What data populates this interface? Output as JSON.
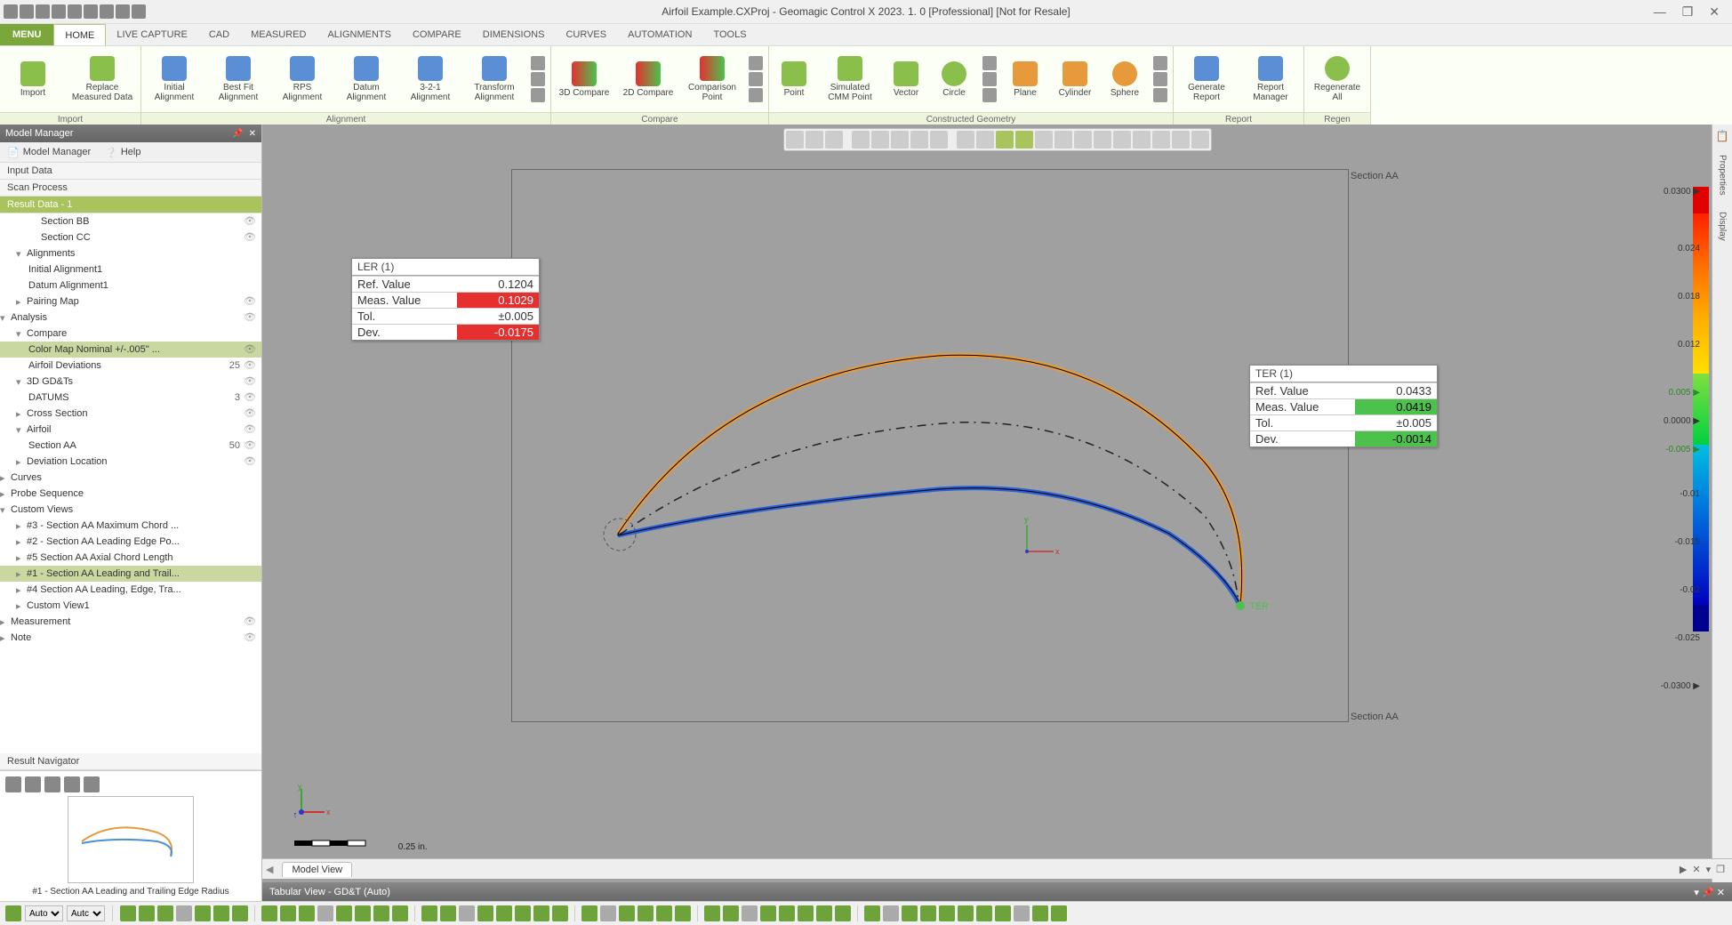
{
  "window": {
    "title": "Airfoil Example.CXProj - Geomagic Control X 2023. 1. 0 [Professional] [Not for Resale]"
  },
  "ribbon": {
    "menu": "MENU",
    "tabs": [
      "HOME",
      "LIVE CAPTURE",
      "CAD",
      "MEASURED",
      "ALIGNMENTS",
      "COMPARE",
      "DIMENSIONS",
      "CURVES",
      "AUTOMATION",
      "TOOLS"
    ],
    "active_tab": 0,
    "groups": [
      {
        "label": "Import",
        "buttons": [
          "Import",
          "Replace Measured Data"
        ]
      },
      {
        "label": "Alignment",
        "buttons": [
          "Initial Alignment",
          "Best Fit Alignment",
          "RPS Alignment",
          "Datum Alignment",
          "3-2-1 Alignment",
          "Transform Alignment"
        ]
      },
      {
        "label": "Compare",
        "buttons": [
          "3D Compare",
          "2D Compare",
          "Comparison Point"
        ]
      },
      {
        "label": "Constructed Geometry",
        "buttons": [
          "Point",
          "Simulated CMM Point",
          "Vector",
          "Circle",
          "",
          "Plane",
          "Cylinder",
          "Sphere",
          ""
        ]
      },
      {
        "label": "Report",
        "buttons": [
          "Generate Report",
          "Report Manager"
        ]
      },
      {
        "label": "Regen",
        "buttons": [
          "Regenerate All"
        ]
      }
    ]
  },
  "left": {
    "panel_title": "Model Manager",
    "tab1": "Model Manager",
    "tab2": "Help",
    "sect_input": "Input Data",
    "sect_scan": "Scan Process",
    "sect_result": "Result Data - 1",
    "sect_nav": "Result Navigator",
    "tree": [
      {
        "lbl": "Section BB",
        "ind": 3,
        "eye": 1
      },
      {
        "lbl": "Section CC",
        "ind": 3,
        "eye": 1
      },
      {
        "lbl": "Alignments",
        "ind": 1,
        "exp": 1
      },
      {
        "lbl": "Initial Alignment1",
        "ind": 2
      },
      {
        "lbl": "Datum Alignment1",
        "ind": 2
      },
      {
        "lbl": "Pairing Map",
        "ind": 1,
        "eye": 1
      },
      {
        "lbl": "Analysis",
        "ind": 0,
        "exp": 1,
        "eye": 1
      },
      {
        "lbl": "Compare",
        "ind": 1,
        "exp": 1
      },
      {
        "lbl": "Color Map Nominal +/-.005\" ...",
        "ind": 2,
        "eye": 1,
        "sel": 1
      },
      {
        "lbl": "Airfoil Deviations",
        "ind": 2,
        "cnt": "25",
        "eye": 1
      },
      {
        "lbl": "3D GD&Ts",
        "ind": 1,
        "exp": 1,
        "eye": 1
      },
      {
        "lbl": "DATUMS",
        "ind": 2,
        "cnt": "3",
        "eye": 1
      },
      {
        "lbl": "Cross Section",
        "ind": 1,
        "eye": 1
      },
      {
        "lbl": "Airfoil",
        "ind": 1,
        "exp": 1,
        "eye": 1
      },
      {
        "lbl": "Section AA",
        "ind": 2,
        "cnt": "50",
        "eye": 1
      },
      {
        "lbl": "Deviation Location",
        "ind": 1,
        "eye": 1
      },
      {
        "lbl": "Curves",
        "ind": 0
      },
      {
        "lbl": "Probe Sequence",
        "ind": 0
      },
      {
        "lbl": "Custom Views",
        "ind": 0,
        "exp": 1
      },
      {
        "lbl": "#3 - Section AA Maximum Chord ...",
        "ind": 1
      },
      {
        "lbl": "#2 - Section AA Leading Edge Po...",
        "ind": 1
      },
      {
        "lbl": "#5 Section AA Axial Chord Length",
        "ind": 1
      },
      {
        "lbl": "#1 - Section AA Leading and Trail...",
        "ind": 1,
        "sel": 1
      },
      {
        "lbl": "#4 Section AA Leading, Edge, Tra...",
        "ind": 1
      },
      {
        "lbl": "Custom View1",
        "ind": 1
      },
      {
        "lbl": "Measurement",
        "ind": 0,
        "eye": 1
      },
      {
        "lbl": "Note",
        "ind": 0,
        "eye": 1
      }
    ],
    "thumb_caption": "#1 - Section AA Leading and Trailing Edge Radius"
  },
  "viewport": {
    "section_label": "Section AA",
    "model_view": "Model View",
    "tabular": "Tabular View - GD&T (Auto)",
    "scale_text": "0.25 in.",
    "ter_marker": "TER",
    "axes": {
      "x": "x",
      "y": "y",
      "z": "z"
    }
  },
  "callouts": {
    "ler": {
      "title": "LER (1)",
      "rows": [
        {
          "k": "Ref. Value",
          "v": "0.1204",
          "cls": ""
        },
        {
          "k": "Meas. Value",
          "v": "0.1029",
          "cls": "red-cell"
        },
        {
          "k": "Tol.",
          "v": "±0.005",
          "cls": ""
        },
        {
          "k": "Dev.",
          "v": "-0.0175",
          "cls": "red-cell"
        }
      ]
    },
    "ter": {
      "title": "TER (1)",
      "rows": [
        {
          "k": "Ref. Value",
          "v": "0.0433",
          "cls": ""
        },
        {
          "k": "Meas. Value",
          "v": "0.0419",
          "cls": "green-cell"
        },
        {
          "k": "Tol.",
          "v": "±0.005",
          "cls": ""
        },
        {
          "k": "Dev.",
          "v": "-0.0014",
          "cls": "green-cell"
        }
      ]
    }
  },
  "color_scale": {
    "labels": [
      "0.0300 ▶",
      "0.024",
      "0.018",
      "0.012",
      "0.005 ▶",
      "0.0000 ▶",
      "-0.005 ▶",
      "-0.01",
      "-0.015",
      "-0.02",
      "-0.025",
      "-0.0300 ▶"
    ]
  },
  "right_panel": {
    "t1": "Properties",
    "t2": "Display"
  },
  "status": {
    "auto1": "Auto",
    "auto2": "Autc"
  }
}
